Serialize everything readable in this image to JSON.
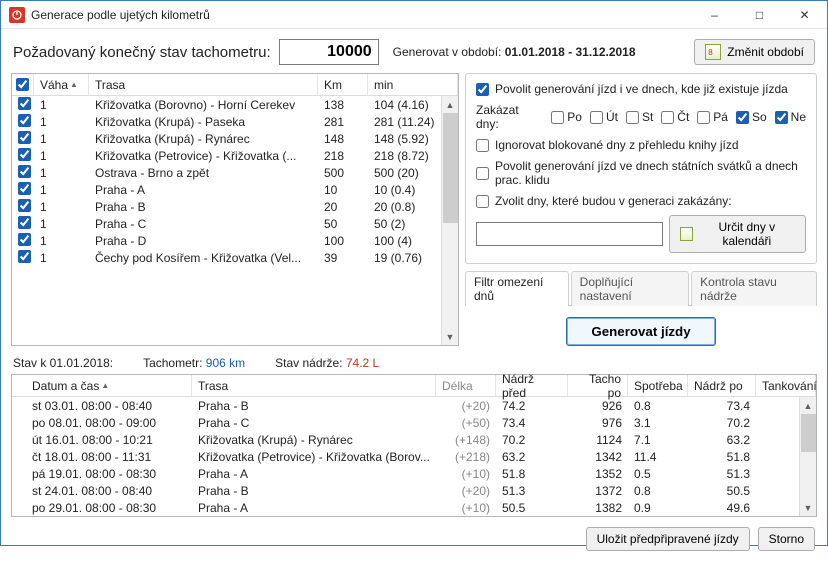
{
  "window": {
    "title": "Generace podle ujetých kilometrů"
  },
  "top": {
    "label": "Požadovaný konečný stav tachometru:",
    "odometer_target": "10000",
    "period_prefix": "Generovat v období:",
    "period_value": "01.01.2018 - 31.12.2018",
    "change_period_btn": "Změnit období"
  },
  "routes": {
    "headers": {
      "weight": "Váha",
      "route": "Trasa",
      "km": "Km",
      "min": "min"
    },
    "rows": [
      {
        "chk": true,
        "w": "1",
        "t": "Křižovatka (Borovno) - Horní Cerekev",
        "km": "138",
        "min": "104 (4.16)"
      },
      {
        "chk": true,
        "w": "1",
        "t": "Křižovatka (Krupá) - Paseka",
        "km": "281",
        "min": "281 (11.24)"
      },
      {
        "chk": true,
        "w": "1",
        "t": "Křižovatka (Krupá) - Rynárec",
        "km": "148",
        "min": "148 (5.92)"
      },
      {
        "chk": true,
        "w": "1",
        "t": "Křižovatka (Petrovice) - Křižovatka (...",
        "km": "218",
        "min": "218 (8.72)"
      },
      {
        "chk": true,
        "w": "1",
        "t": "Ostrava - Brno a zpět",
        "km": "500",
        "min": "500 (20)"
      },
      {
        "chk": true,
        "w": "1",
        "t": "Praha - A",
        "km": "10",
        "min": "10 (0.4)"
      },
      {
        "chk": true,
        "w": "1",
        "t": "Praha - B",
        "km": "20",
        "min": "20 (0.8)"
      },
      {
        "chk": true,
        "w": "1",
        "t": "Praha - C",
        "km": "50",
        "min": "50 (2)"
      },
      {
        "chk": true,
        "w": "1",
        "t": "Praha - D",
        "km": "100",
        "min": "100 (4)"
      },
      {
        "chk": true,
        "w": "1",
        "t": "Čechy pod Kosířem - Křižovatka (Vel...",
        "km": "39",
        "min": "19 (0.76)"
      }
    ]
  },
  "options": {
    "allow_existing": {
      "checked": true,
      "label": "Povolit generování jízd i ve dnech, kde již existuje jízda"
    },
    "ban_days_label": "Zakázat dny:",
    "days": [
      {
        "code": "Po",
        "checked": false
      },
      {
        "code": "Út",
        "checked": false
      },
      {
        "code": "St",
        "checked": false
      },
      {
        "code": "Čt",
        "checked": false
      },
      {
        "code": "Pá",
        "checked": false
      },
      {
        "code": "So",
        "checked": true
      },
      {
        "code": "Ne",
        "checked": true
      }
    ],
    "ignore_blocked": {
      "checked": false,
      "label": "Ignorovat blokované dny z přehledu knihy jízd"
    },
    "allow_holidays": {
      "checked": false,
      "label": "Povolit generování jízd ve dnech státních svátků a dnech prac. klidu"
    },
    "pick_days": {
      "checked": false,
      "label": "Zvolit dny, které budou v generaci zakázány:"
    },
    "banned_dates_value": "",
    "calendar_btn": "Určit dny v kalendáři",
    "tabs": {
      "t1": "Filtr omezení dnů",
      "t2": "Doplňující nastavení",
      "t3": "Kontrola stavu nádrže"
    },
    "generate_btn": "Generovat  jízdy"
  },
  "status": {
    "date_label": "Stav k 01.01.2018:",
    "odo_label": "Tachometr:",
    "odo_value": "906 km",
    "tank_label": "Stav nádrže:",
    "tank_value": "74.2 L"
  },
  "trips": {
    "headers": {
      "dt": "Datum a čas",
      "route": "Trasa",
      "len": "Délka",
      "nbef": "Nádrž před",
      "odo": "Tacho po",
      "cons": "Spotřeba",
      "naft": "Nádrž po",
      "tank": "Tankování"
    },
    "rows": [
      {
        "dt": "st 03.01. 08:00 - 08:40",
        "tr": "Praha - B",
        "len": "(+20)",
        "nbef": "74.2",
        "odo": "926",
        "cons": "0.8",
        "naft": "73.4"
      },
      {
        "dt": "po 08.01. 08:00 - 09:00",
        "tr": "Praha - C",
        "len": "(+50)",
        "nbef": "73.4",
        "odo": "976",
        "cons": "3.1",
        "naft": "70.2"
      },
      {
        "dt": "út 16.01. 08:00 - 10:21",
        "tr": "Křižovatka (Krupá) - Rynárec",
        "len": "(+148)",
        "nbef": "70.2",
        "odo": "1124",
        "cons": "7.1",
        "naft": "63.2"
      },
      {
        "dt": "čt 18.01. 08:00 - 11:31",
        "tr": "Křižovatka (Petrovice) - Křižovatka (Borov...",
        "len": "(+218)",
        "nbef": "63.2",
        "odo": "1342",
        "cons": "11.4",
        "naft": "51.8"
      },
      {
        "dt": "pá 19.01. 08:00 - 08:30",
        "tr": "Praha - A",
        "len": "(+10)",
        "nbef": "51.8",
        "odo": "1352",
        "cons": "0.5",
        "naft": "51.3"
      },
      {
        "dt": "st 24.01. 08:00 - 08:40",
        "tr": "Praha - B",
        "len": "(+20)",
        "nbef": "51.3",
        "odo": "1372",
        "cons": "0.8",
        "naft": "50.5"
      },
      {
        "dt": "po 29.01. 08:00 - 08:30",
        "tr": "Praha - A",
        "len": "(+10)",
        "nbef": "50.5",
        "odo": "1382",
        "cons": "0.9",
        "naft": "49.6"
      }
    ]
  },
  "footer": {
    "save": "Uložit předpřipravené jízdy",
    "cancel": "Storno"
  }
}
